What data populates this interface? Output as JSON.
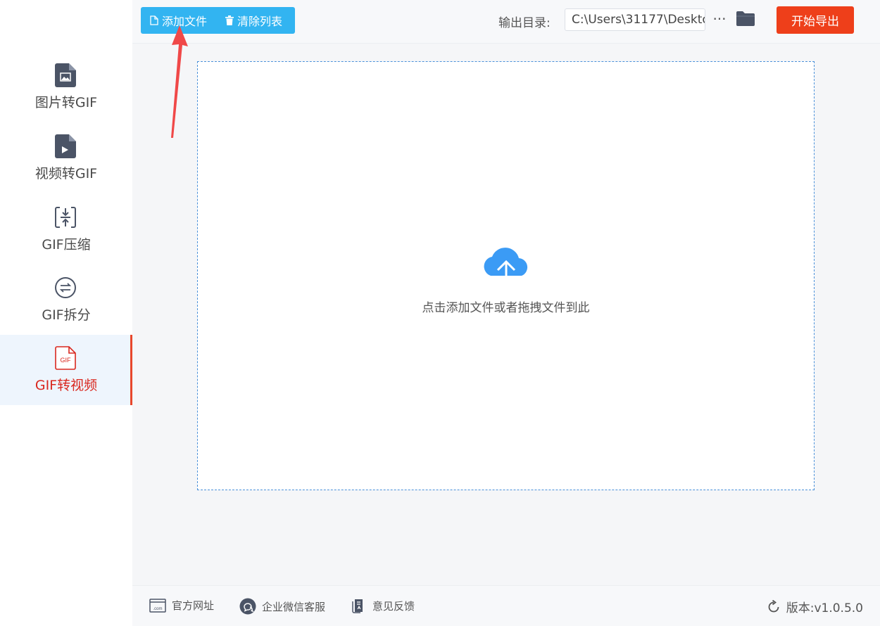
{
  "sidebar": {
    "items": [
      {
        "label": "图片转GIF",
        "icon": "image-file-icon",
        "active": false
      },
      {
        "label": "视频转GIF",
        "icon": "video-file-icon",
        "active": false
      },
      {
        "label": "GIF压缩",
        "icon": "compress-icon",
        "active": false
      },
      {
        "label": "GIF拆分",
        "icon": "split-icon",
        "active": false
      },
      {
        "label": "GIF转视频",
        "icon": "gif-file-icon",
        "active": true
      }
    ]
  },
  "toolbar": {
    "add_file_label": "添加文件",
    "clear_list_label": "清除列表",
    "output_dir_label": "输出目录:",
    "output_dir_value": "C:\\Users\\31177\\Deskto",
    "more_label": "···",
    "export_label": "开始导出"
  },
  "dropzone": {
    "hint": "点击添加文件或者拖拽文件到此",
    "icon": "cloud-upload-icon"
  },
  "footer": {
    "website_label": "官方网址",
    "wechat_label": "企业微信客服",
    "feedback_label": "意见反馈",
    "version_label": "版本:v1.0.5.0"
  },
  "colors": {
    "primary_blue": "#32b4f1",
    "export_red": "#ee3f1a",
    "active_red": "#d9271e",
    "cloud_blue": "#3b9bf5",
    "annotation_arrow": "#f04848"
  }
}
